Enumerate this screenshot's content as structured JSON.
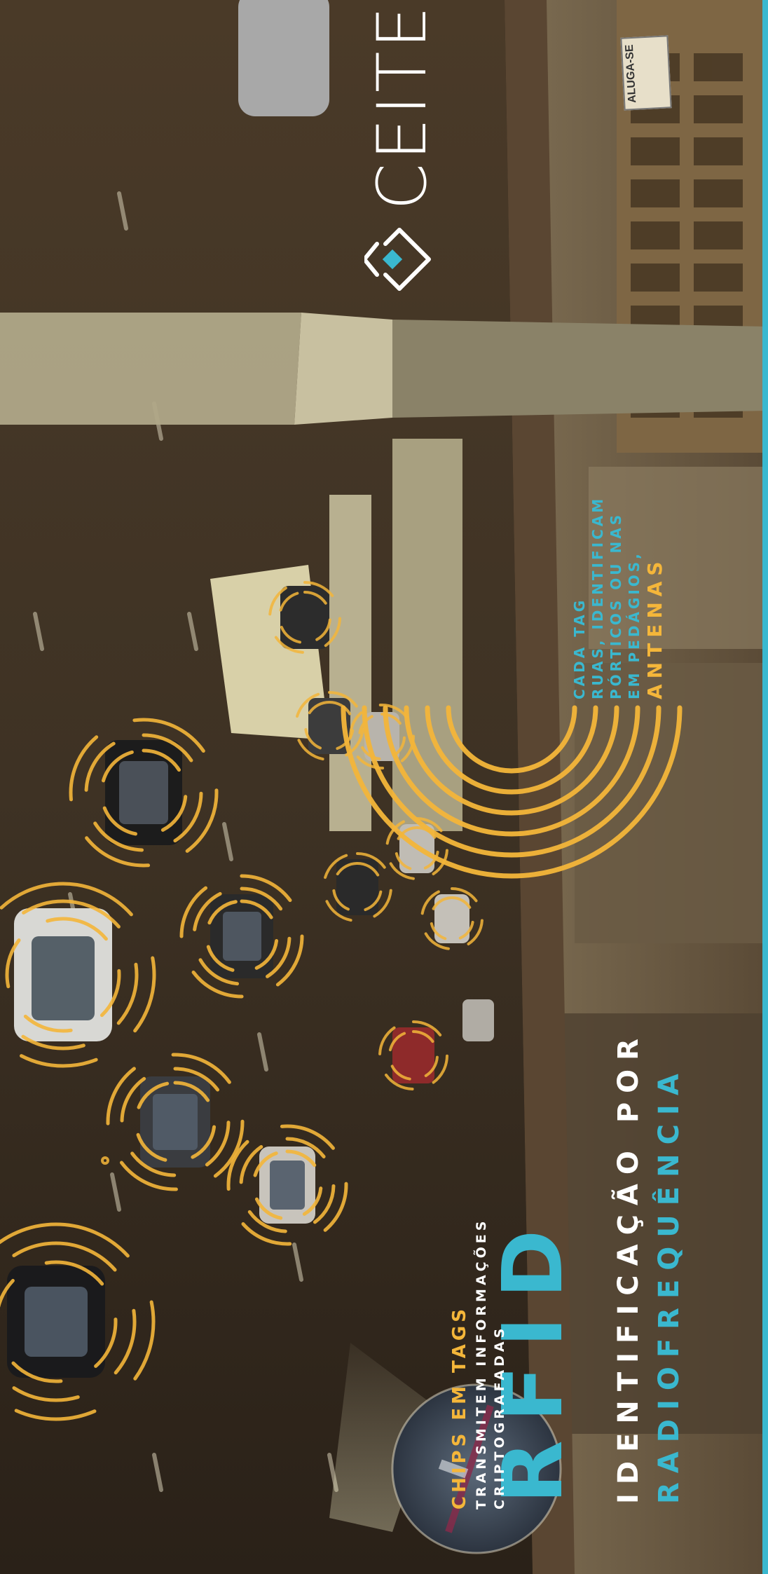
{
  "colors": {
    "accent_cyan": "#3ab8cf",
    "accent_yellow": "#f4b63a",
    "white": "#ffffff",
    "road": "#3b3022",
    "sky_tint": "#6a5a44"
  },
  "logo": {
    "text": "CEITEC",
    "mark_icon": "ceitec-diamond-icon"
  },
  "title": {
    "main": "RFID",
    "line1": "IDENTIFICAÇÃO POR",
    "line2": "RADIOFREQUÊNCIA"
  },
  "chips": {
    "title": "CHIPS EM TAGS",
    "desc_lines": [
      "TRANSMITEM INFORMAÇÕES",
      "CRIPTOGRAFADAS"
    ]
  },
  "antenas": {
    "title": "ANTENAS",
    "desc_lines": [
      "EM PEDÁGIOS,",
      "PÓRTICOS OU NAS",
      "RUAS, IDENTIFICAM",
      "CADA TAG"
    ]
  },
  "signs": {
    "alugase": "ALUGA-SE"
  }
}
